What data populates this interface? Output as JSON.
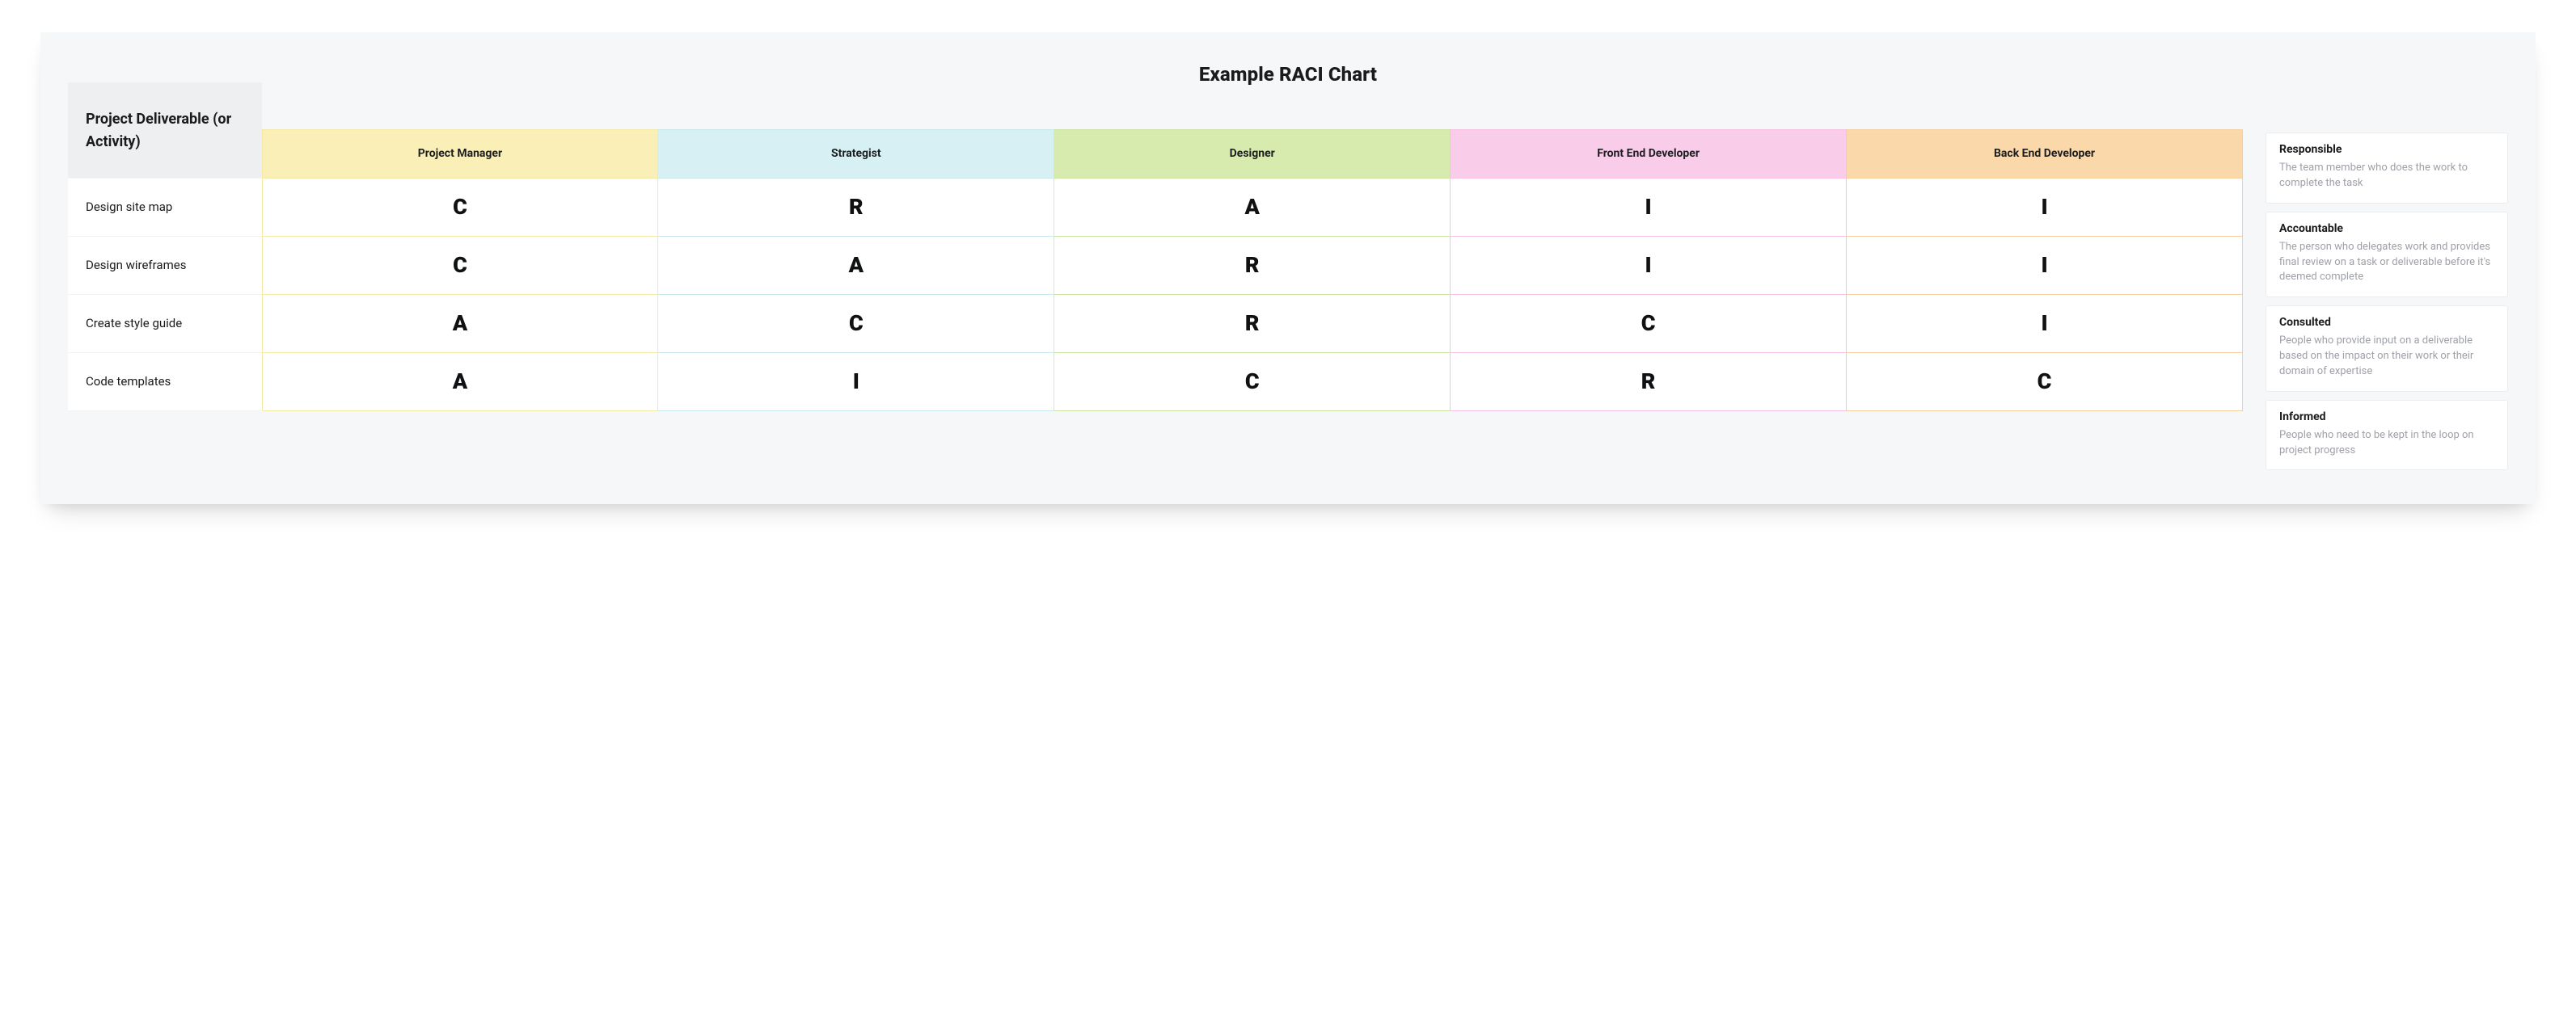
{
  "title": "Example RACI Chart",
  "corner_label": "Project Deliverable (or Activity)",
  "roles": [
    {
      "label": "Project Manager",
      "color": "yellow"
    },
    {
      "label": "Strategist",
      "color": "blue"
    },
    {
      "label": "Designer",
      "color": "green"
    },
    {
      "label": "Front End Developer",
      "color": "pink"
    },
    {
      "label": "Back End Developer",
      "color": "orange"
    }
  ],
  "activities": [
    {
      "label": "Design site map",
      "values": [
        "C",
        "R",
        "A",
        "I",
        "I"
      ]
    },
    {
      "label": "Design wireframes",
      "values": [
        "C",
        "A",
        "R",
        "I",
        "I"
      ]
    },
    {
      "label": "Create style guide",
      "values": [
        "A",
        "C",
        "R",
        "C",
        "I"
      ]
    },
    {
      "label": "Code templates",
      "values": [
        "A",
        "I",
        "C",
        "R",
        "C"
      ]
    }
  ],
  "legend": [
    {
      "term": "Responsible",
      "def": "The team member who does the work to complete the task"
    },
    {
      "term": "Accountable",
      "def": "The person who delegates work and provides final review on a task or deliverable before it's deemed complete"
    },
    {
      "term": "Consulted",
      "def": "People who provide input on a deliverable based on the impact on their work or their domain of expertise"
    },
    {
      "term": "Informed",
      "def": "People who need to be kept in the loop on project progress"
    }
  ],
  "chart_data": {
    "type": "table",
    "title": "Example RACI Chart",
    "row_dimension": "Project Deliverable (or Activity)",
    "columns": [
      "Project Manager",
      "Strategist",
      "Designer",
      "Front End Developer",
      "Back End Developer"
    ],
    "rows": [
      "Design site map",
      "Design wireframes",
      "Create style guide",
      "Code templates"
    ],
    "matrix": [
      [
        "C",
        "R",
        "A",
        "I",
        "I"
      ],
      [
        "C",
        "A",
        "R",
        "I",
        "I"
      ],
      [
        "A",
        "C",
        "R",
        "C",
        "I"
      ],
      [
        "A",
        "I",
        "C",
        "R",
        "C"
      ]
    ],
    "value_meanings": {
      "R": "Responsible",
      "A": "Accountable",
      "C": "Consulted",
      "I": "Informed"
    }
  }
}
